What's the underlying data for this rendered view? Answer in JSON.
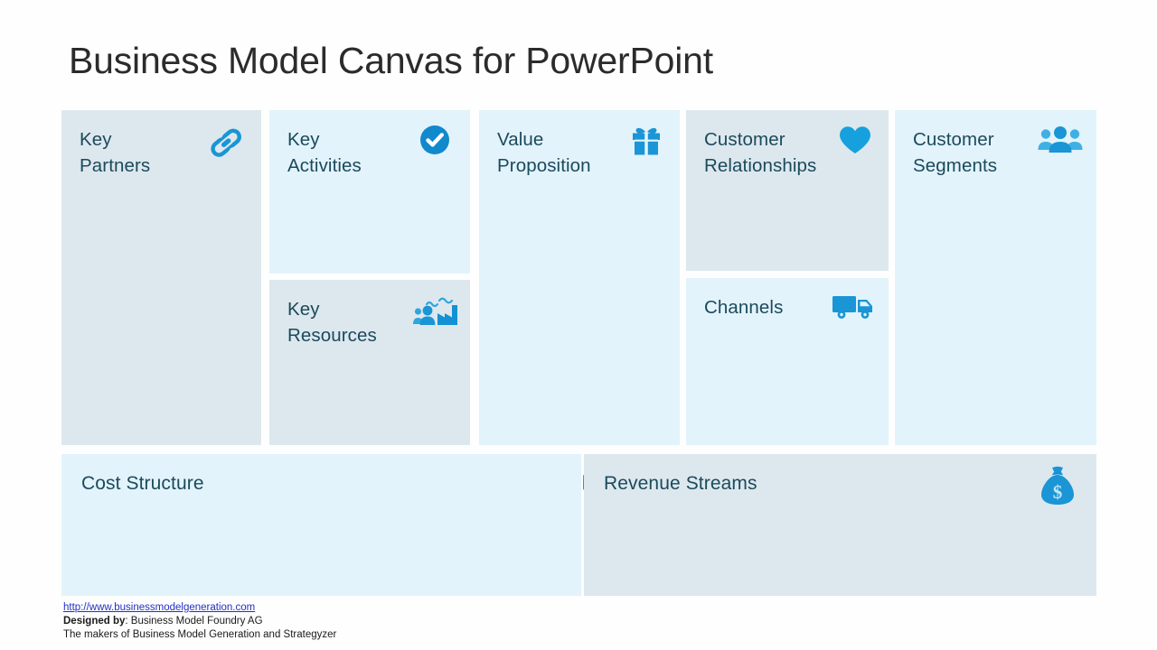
{
  "slide": {
    "title": "Business Model Canvas for PowerPoint",
    "background_color": "#fefefe",
    "title_color": "#2b2b2b"
  },
  "theme": {
    "panel_gray_blue": "#dde8ee",
    "panel_light_cyan": "#e2f3fb",
    "icon_blue": "#1a95d5",
    "icon_blue_dark": "#0e86c8",
    "icon_blue_light": "#5cbfe8",
    "title_text_color": "#1b4a5c",
    "link_color": "#2330c4"
  },
  "panels": [
    {
      "id": "key-partners",
      "title": "Key\nPartners",
      "icon": "chain-link-icon",
      "tone": "#dde8ee"
    },
    {
      "id": "key-activities",
      "title": "Key\nActivities",
      "icon": "check-circle-icon",
      "tone": "#e2f3fb"
    },
    {
      "id": "key-resources",
      "title": "Key\nResources",
      "icon": "people-factory-icon",
      "tone": "#dde8ee"
    },
    {
      "id": "value-proposition",
      "title": "Value\nProposition",
      "icon": "gift-box-icon",
      "tone": "#e2f3fb"
    },
    {
      "id": "customer-relationships",
      "title": "Customer\nRelationships",
      "icon": "heart-icon",
      "tone": "#dde8ee"
    },
    {
      "id": "channels",
      "title": "Channels",
      "icon": "delivery-truck-icon",
      "tone": "#e2f3fb"
    },
    {
      "id": "customer-segments",
      "title": "Customer\nSegments",
      "icon": "people-group-icon",
      "tone": "#e2f3fb"
    },
    {
      "id": "cost-structure",
      "title": "Cost Structure",
      "icon": "price-tags-icon",
      "tone": "#e2f3fb"
    },
    {
      "id": "revenue-streams",
      "title": "Revenue Streams",
      "icon": "money-bag-icon",
      "tone": "#dde8ee"
    }
  ],
  "footer": {
    "url": "http://www.businessmodelgeneration.com",
    "designed_by_label": "Designed by",
    "designed_by_separator": ": ",
    "designed_by_value": "Business Model Foundry AG",
    "tagline": "The makers of Business Model Generation and Strategyzer"
  }
}
